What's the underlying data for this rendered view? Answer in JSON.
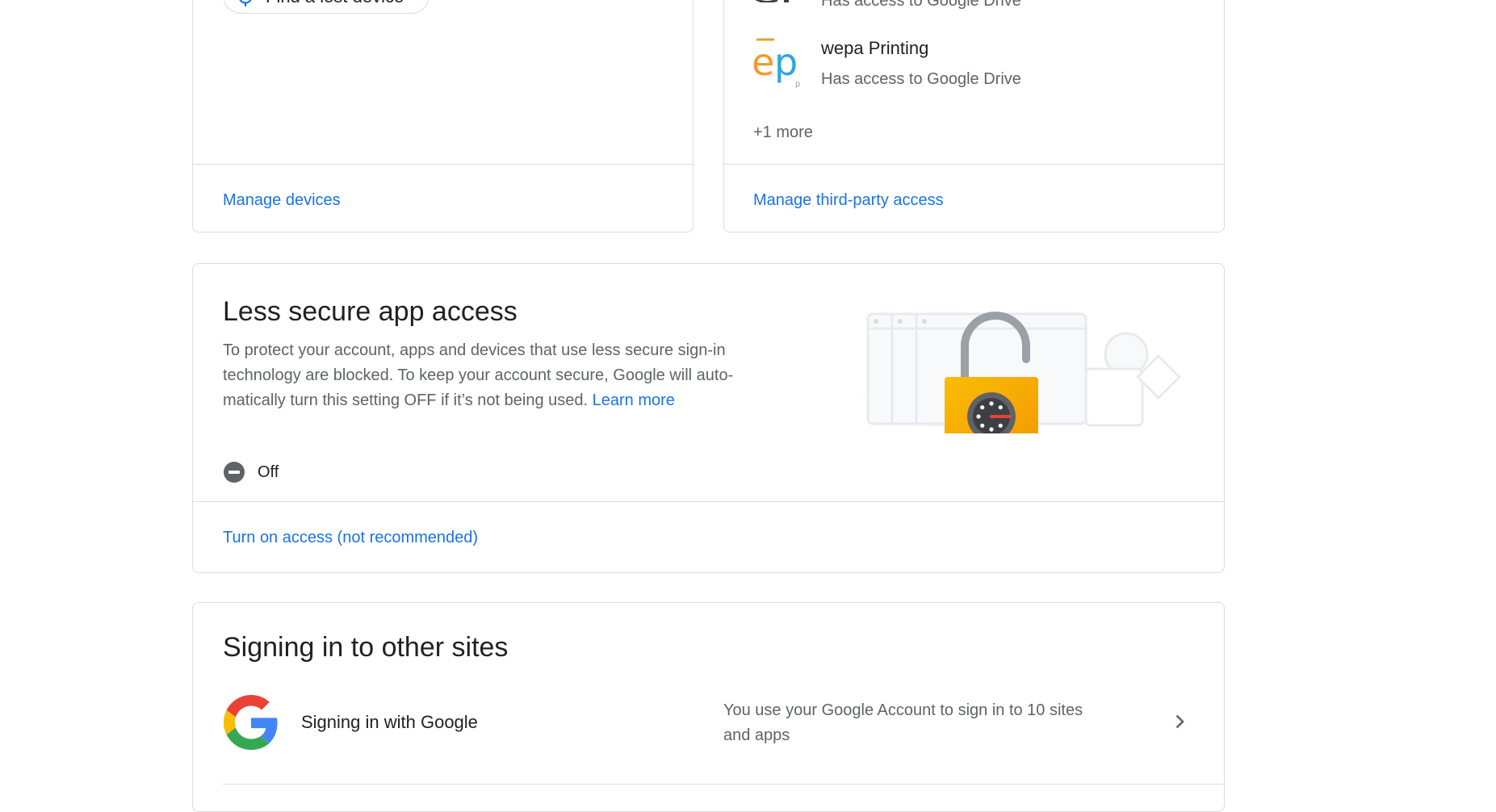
{
  "devices_card": {
    "find_device_label": "Find a lost device",
    "manage_devices_link": "Manage devices"
  },
  "third_party_card": {
    "apps": [
      {
        "name": "",
        "access": "Has access to Google Drive"
      },
      {
        "name": "wepa Printing",
        "access": "Has access to Google Drive"
      }
    ],
    "more_label": "+1 more",
    "manage_link": "Manage third-party access"
  },
  "less_secure": {
    "title": "Less secure app access",
    "desc_line1": "To protect your account, apps and devices that use less secure sign-in",
    "desc_line2": "technology are blocked. To keep your account secure, Google will auto-",
    "desc_line3": "matically turn this setting OFF if it’s not being used.",
    "learn_more": "Learn more",
    "status_label": "Off",
    "turn_on_link": "Turn on access (not recommended)"
  },
  "other_sites": {
    "title": "Signing in to other sites",
    "row_label": "Signing in with Google",
    "row_desc_line1": "You use your Google Account to sign in to 10 sites",
    "row_desc_line2": "and apps"
  },
  "icons": {
    "find_device": "crosshair-icon",
    "status_off": "minus-circle-icon",
    "google_logo": "google-g-icon",
    "chevron": "chevron-right-icon",
    "lock": "padlock-illustration"
  },
  "colors": {
    "link": "#1a73e8",
    "border": "#dadce0",
    "lock_gold": "#f9ab00",
    "status_icon": "#5f6368"
  }
}
